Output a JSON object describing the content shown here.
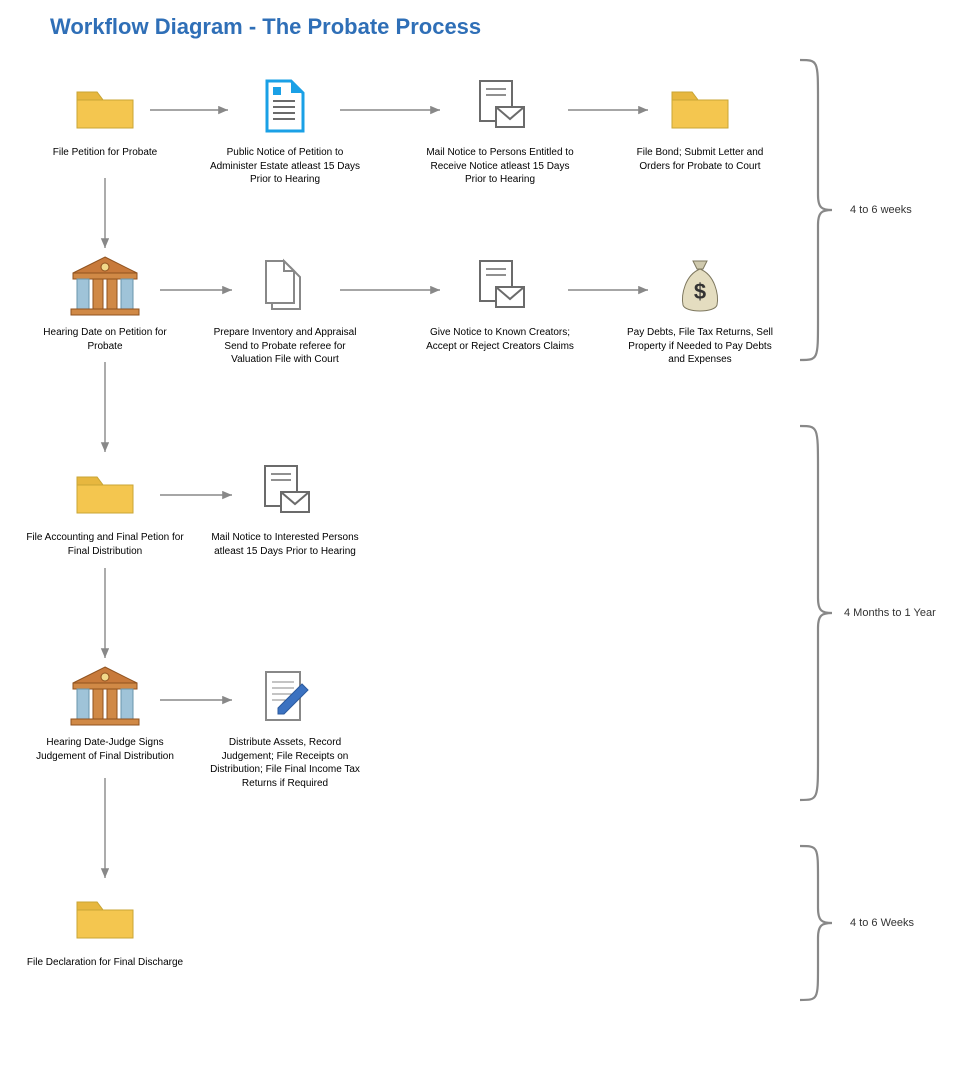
{
  "title": "Workflow Diagram - The Probate Process",
  "nodes": {
    "n1": {
      "label": "File Petition for Probate"
    },
    "n2": {
      "label": "Public Notice of Petition to Administer Estate atleast 15 Days Prior to Hearing"
    },
    "n3": {
      "label": "Mail Notice to Persons Entitled to Receive Notice atleast 15 Days Prior to Hearing"
    },
    "n4": {
      "label": "File Bond; Submit Letter and Orders for Probate to Court"
    },
    "n5": {
      "label": "Hearing Date on Petition for Probate"
    },
    "n6": {
      "label": "Prepare Inventory and Appraisal Send to Probate referee for Valuation File with Court"
    },
    "n7": {
      "label": "Give Notice to Known Creators; Accept or Reject Creators Claims"
    },
    "n8": {
      "label": "Pay Debts, File Tax Returns, Sell Property if Needed to Pay Debts and Expenses"
    },
    "n9": {
      "label": "File Accounting and Final Petion for Final Distribution"
    },
    "n10": {
      "label": "Mail Notice to Interested Persons atleast 15 Days Prior to Hearing"
    },
    "n11": {
      "label": "Hearing Date-Judge Signs Judgement of Final Distribution"
    },
    "n12": {
      "label": "Distribute Assets, Record Judgement; File Receipts on Distribution; File Final Income Tax Returns if Required"
    },
    "n13": {
      "label": "File Declaration for Final Discharge"
    }
  },
  "durations": {
    "d1": "4 to 6 weeks",
    "d2": "4 Months to 1 Year",
    "d3": "4 to 6 Weeks"
  }
}
